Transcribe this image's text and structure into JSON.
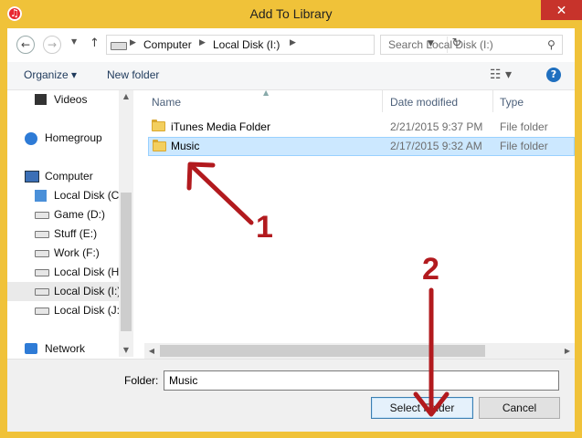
{
  "window": {
    "title": "Add To Library",
    "close_glyph": "✕",
    "accent": "#f0c239",
    "close_color": "#c7332b"
  },
  "nav": {
    "back_glyph": "←",
    "forward_glyph": "→",
    "up_glyph": "↑",
    "breadcrumb": [
      "Computer",
      "Local Disk (I:)"
    ],
    "search_placeholder": "Search Local Disk (I:)"
  },
  "toolbar": {
    "organize": "Organize ▾",
    "new_folder": "New folder"
  },
  "sidebar": {
    "items": [
      {
        "label": "Videos"
      },
      {
        "label": "Homegroup"
      },
      {
        "label": "Computer"
      },
      {
        "label": "Local Disk (C:)"
      },
      {
        "label": "Game (D:)"
      },
      {
        "label": "Stuff (E:)"
      },
      {
        "label": "Work (F:)"
      },
      {
        "label": "Local Disk (H:)"
      },
      {
        "label": "Local Disk (I:)"
      },
      {
        "label": "Local Disk (J:)"
      },
      {
        "label": "Network"
      }
    ]
  },
  "columns": {
    "name": "Name",
    "date": "Date modified",
    "type": "Type"
  },
  "files": [
    {
      "name": "iTunes Media Folder",
      "date": "2/21/2015 9:37 PM",
      "type": "File folder"
    },
    {
      "name": "Music",
      "date": "2/17/2015 9:32 AM",
      "type": "File folder"
    }
  ],
  "footer": {
    "folder_label": "Folder:",
    "folder_value": "Music",
    "select_button": "Select Folder",
    "cancel_button": "Cancel"
  },
  "annotations": {
    "step1": "1",
    "step2": "2",
    "color": "#b21a1e"
  }
}
